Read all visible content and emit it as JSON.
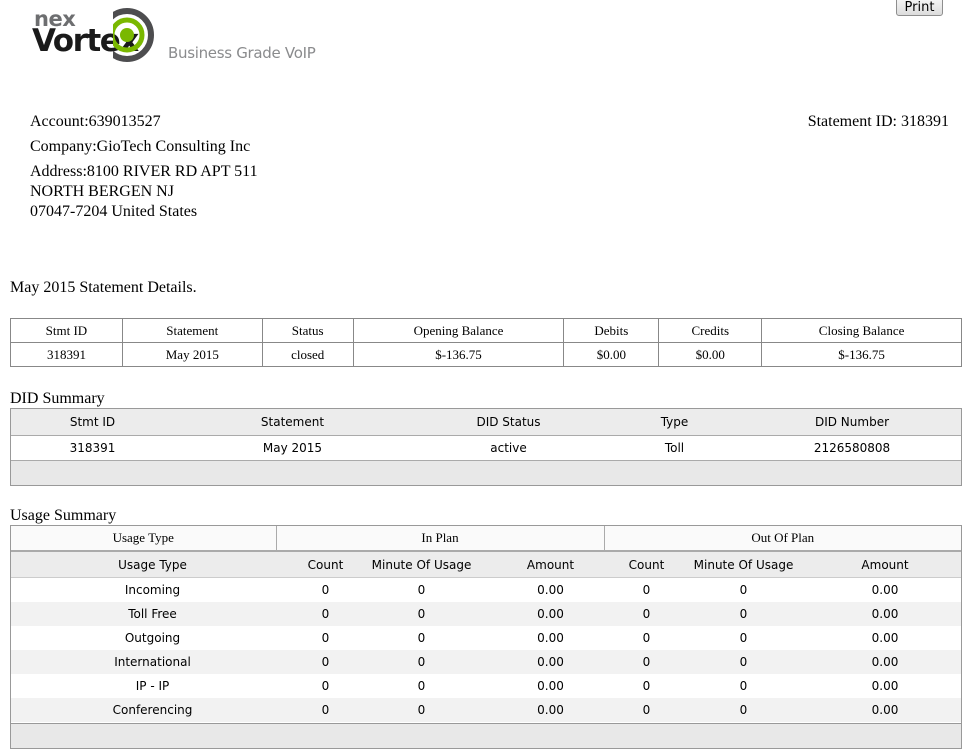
{
  "logo": {
    "nex": "nex",
    "vortex": "Vortex",
    "tagline": "Business Grade VoIP"
  },
  "toolbar": {
    "print_label": "Print"
  },
  "account": {
    "account_label": "Account:",
    "account_number": "639013527",
    "company_label": "Company:",
    "company": "GioTech Consulting Inc",
    "address_label": "Address:",
    "address_line1": "8100 RIVER RD APT 511",
    "address_line2": "NORTH BERGEN NJ",
    "address_line3": "07047-7204 United States",
    "statement_id_label": "Statement ID:",
    "statement_id": "318391"
  },
  "statement_details": {
    "title": "May 2015 Statement Details.",
    "headers": [
      "Stmt ID",
      "Statement",
      "Status",
      "Opening Balance",
      "Debits",
      "Credits",
      "Closing Balance"
    ],
    "row": [
      "318391",
      "May 2015",
      "closed",
      "$-136.75",
      "$0.00",
      "$0.00",
      "$-136.75"
    ]
  },
  "did_summary": {
    "title": "DID Summary",
    "headers": [
      "Stmt ID",
      "Statement",
      "DID Status",
      "Type",
      "DID Number"
    ],
    "row": [
      "318391",
      "May 2015",
      "active",
      "Toll",
      "2126580808"
    ]
  },
  "usage_summary": {
    "title": "Usage Summary",
    "groups": [
      "Usage Type",
      "In Plan",
      "Out Of Plan"
    ],
    "headers": [
      "Usage Type",
      "Count",
      "Minute Of Usage",
      "Amount",
      "Count",
      "Minute Of Usage",
      "Amount"
    ],
    "rows": [
      [
        "Incoming",
        "0",
        "0",
        "0.00",
        "0",
        "0",
        "0.00"
      ],
      [
        "Toll Free",
        "0",
        "0",
        "0.00",
        "0",
        "0",
        "0.00"
      ],
      [
        "Outgoing",
        "0",
        "0",
        "0.00",
        "0",
        "0",
        "0.00"
      ],
      [
        "International",
        "0",
        "0",
        "0.00",
        "0",
        "0",
        "0.00"
      ],
      [
        "IP - IP",
        "0",
        "0",
        "0.00",
        "0",
        "0",
        "0.00"
      ],
      [
        "Conferencing",
        "0",
        "0",
        "0.00",
        "0",
        "0",
        "0.00"
      ]
    ]
  },
  "colors": {
    "logo_green": "#7ab800",
    "logo_gray": "#6d6e70",
    "header_bg": "#ececec",
    "alt_row_bg": "#f2f2f2"
  }
}
